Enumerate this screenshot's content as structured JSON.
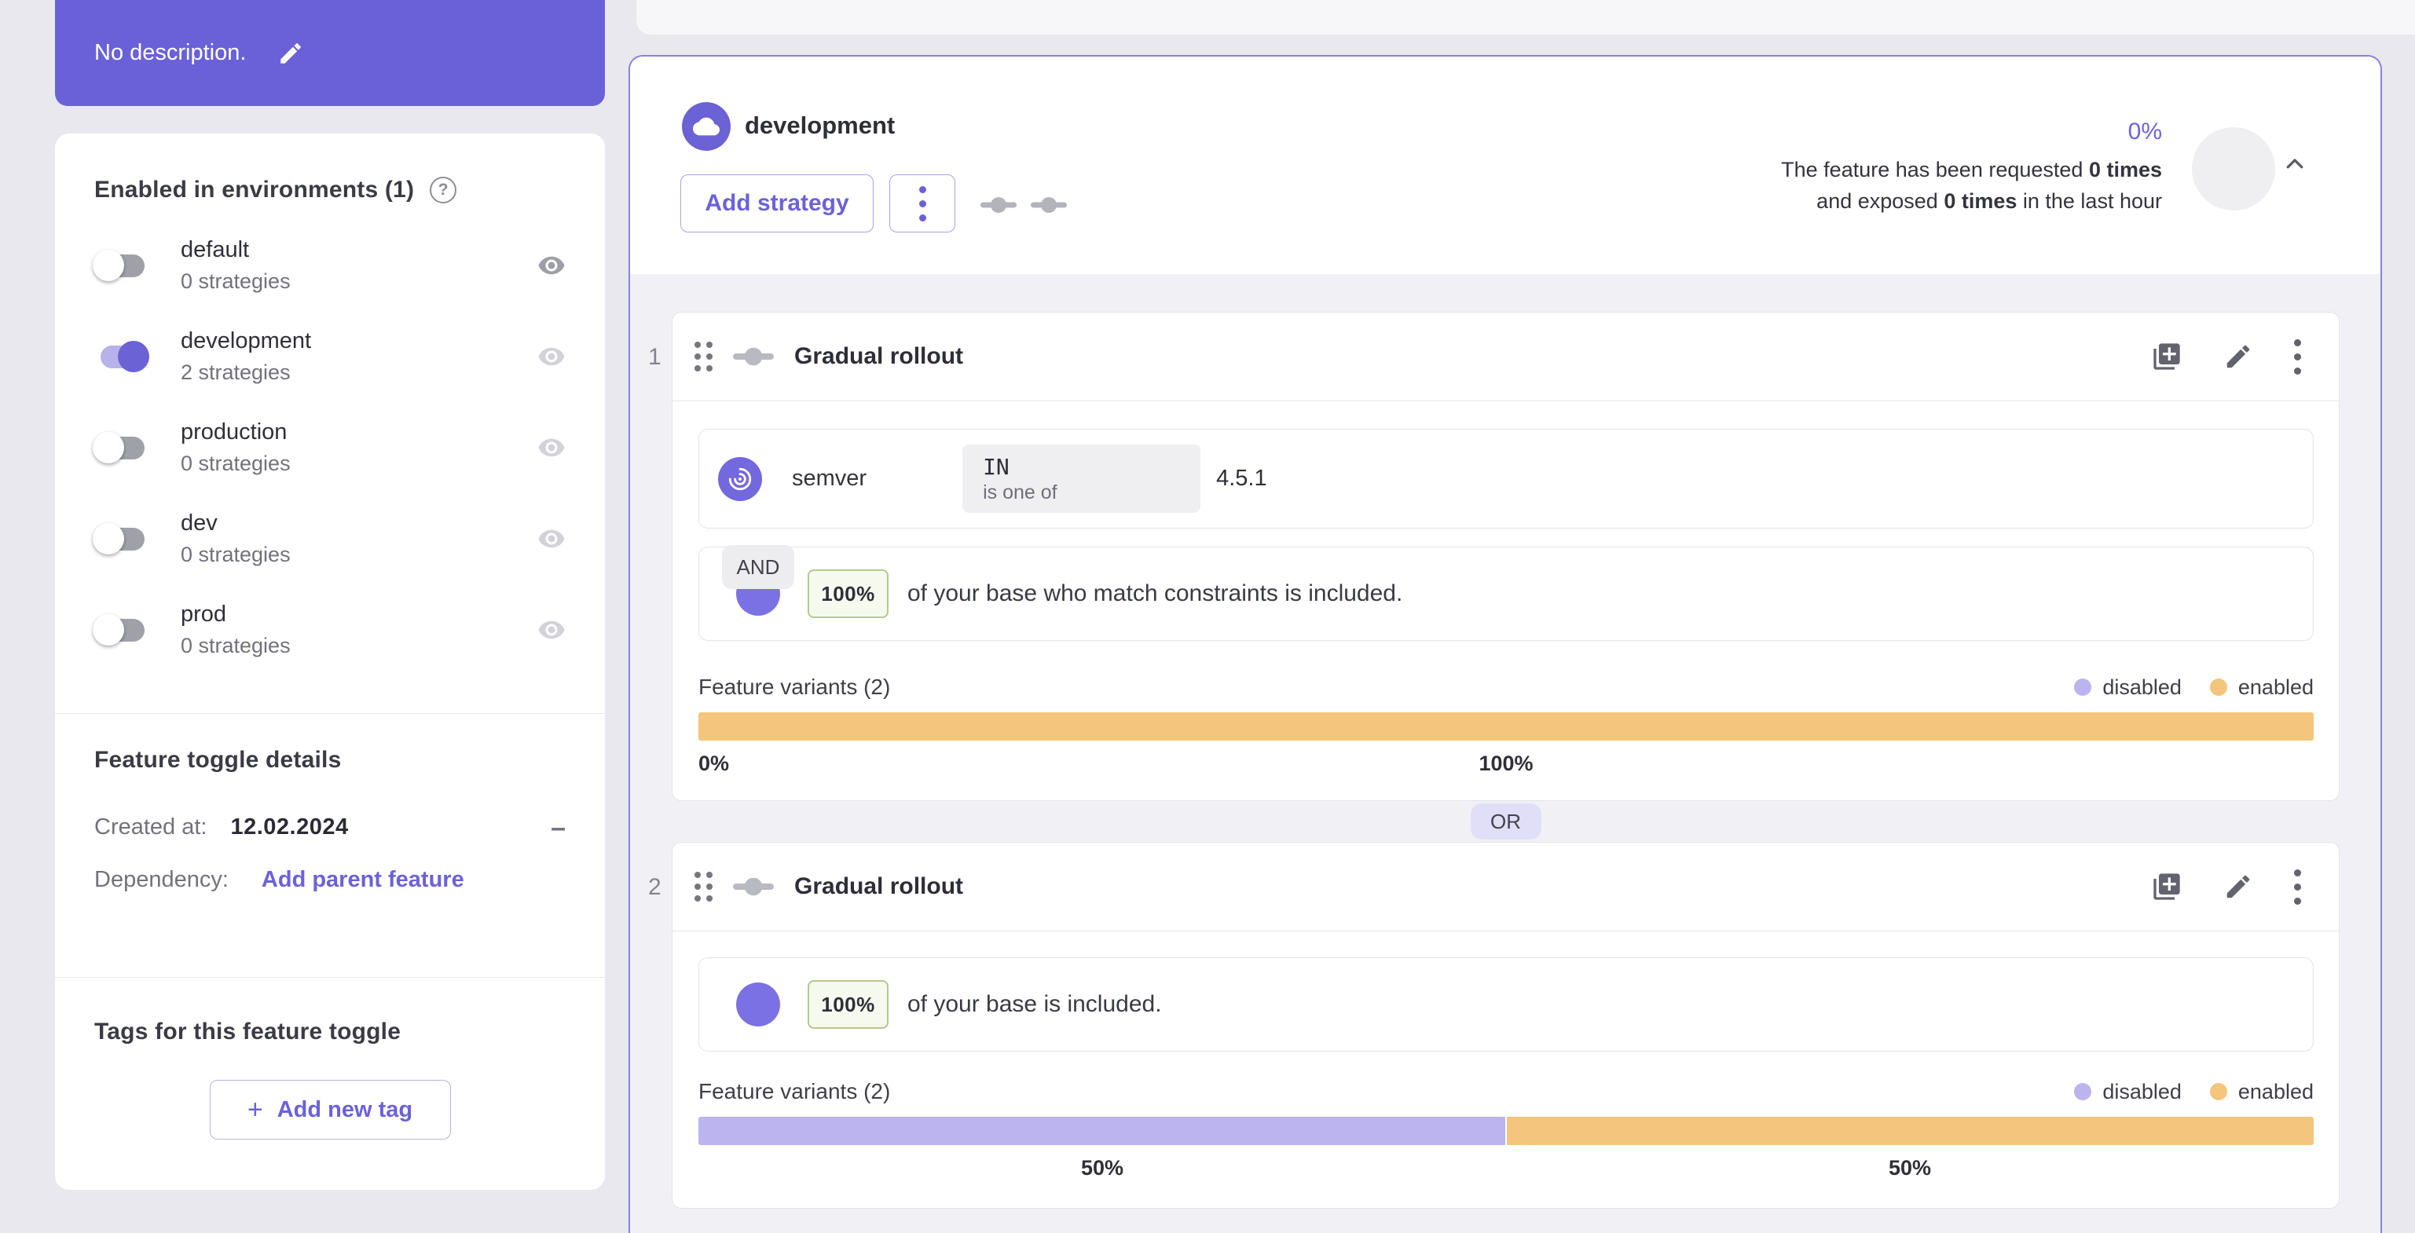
{
  "colors": {
    "primary": "#6b61d9",
    "disabled": "#bcb4ee",
    "enabled": "#f4c57d",
    "accent_border": "#8a81db"
  },
  "description_card": {
    "text": "No description."
  },
  "sidebar": {
    "environments": {
      "title": "Enabled in environments (1)",
      "items": [
        {
          "name": "default",
          "strategies": "0 strategies",
          "enabled": false
        },
        {
          "name": "development",
          "strategies": "2 strategies",
          "enabled": true
        },
        {
          "name": "production",
          "strategies": "0 strategies",
          "enabled": false
        },
        {
          "name": "dev",
          "strategies": "0 strategies",
          "enabled": false
        },
        {
          "name": "prod",
          "strategies": "0 strategies",
          "enabled": false
        }
      ]
    },
    "details": {
      "title": "Feature toggle details",
      "created_label": "Created at:",
      "created_value": "12.02.2024",
      "collapse_glyph": "–",
      "dependency_label": "Dependency:",
      "dependency_action": "Add parent feature"
    },
    "tags": {
      "title": "Tags for this feature toggle",
      "add_button": "Add new tag",
      "plus_glyph": "+"
    }
  },
  "main": {
    "environment_name": "development",
    "add_strategy_label": "Add strategy",
    "metrics": {
      "percent": "0%",
      "line1_prefix": "The feature has been requested ",
      "line1_bold": "0 times",
      "line2_prefix": "and exposed ",
      "line2_bold": "0 times",
      "line2_suffix": " in the last hour"
    },
    "or_label": "OR",
    "strategies": [
      {
        "index": "1",
        "title": "Gradual rollout",
        "constraint": {
          "context_name": "semver",
          "operator": "IN",
          "operator_caption": "is one of",
          "value": "4.5.1",
          "joiner": "AND"
        },
        "rollout": {
          "percentage": "100%",
          "text": "of your base who match constraints is included."
        },
        "variants": {
          "label": "Feature variants (2)",
          "legend": [
            {
              "key": "disabled",
              "label": "disabled"
            },
            {
              "key": "enabled",
              "label": "enabled"
            }
          ],
          "segments": [
            {
              "type": "disabled",
              "value": 0
            },
            {
              "type": "enabled",
              "value": 100
            }
          ],
          "labels": [
            "0%",
            "100%"
          ]
        }
      },
      {
        "index": "2",
        "title": "Gradual rollout",
        "rollout": {
          "percentage": "100%",
          "text": "of your base is included."
        },
        "variants": {
          "label": "Feature variants (2)",
          "legend": [
            {
              "key": "disabled",
              "label": "disabled"
            },
            {
              "key": "enabled",
              "label": "enabled"
            }
          ],
          "segments": [
            {
              "type": "disabled",
              "value": 50
            },
            {
              "type": "enabled",
              "value": 50
            }
          ],
          "labels": [
            "50%",
            "50%"
          ]
        }
      }
    ]
  }
}
